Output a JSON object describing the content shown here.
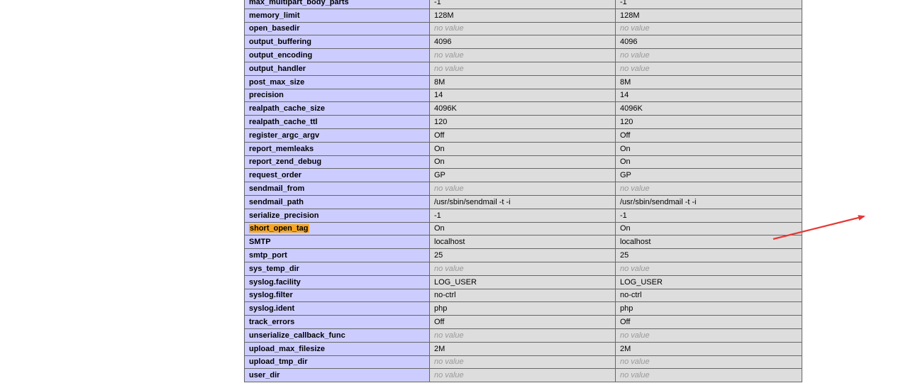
{
  "annotation": {
    "arrow_color": "#e53935",
    "arrow_target_row": "short_open_tag",
    "highlight_color": "#f5a623"
  },
  "colors": {
    "key_cell": "#ccccff",
    "value_cell": "#dddddd",
    "no_value_text": "#999999"
  },
  "rows": [
    {
      "name": "max_multipart_body_parts",
      "local": "-1",
      "master": "-1",
      "local_no": false,
      "master_no": false
    },
    {
      "name": "memory_limit",
      "local": "128M",
      "master": "128M",
      "local_no": false,
      "master_no": false
    },
    {
      "name": "open_basedir",
      "local": "no value",
      "master": "no value",
      "local_no": true,
      "master_no": true
    },
    {
      "name": "output_buffering",
      "local": "4096",
      "master": "4096",
      "local_no": false,
      "master_no": false
    },
    {
      "name": "output_encoding",
      "local": "no value",
      "master": "no value",
      "local_no": true,
      "master_no": true
    },
    {
      "name": "output_handler",
      "local": "no value",
      "master": "no value",
      "local_no": true,
      "master_no": true
    },
    {
      "name": "post_max_size",
      "local": "8M",
      "master": "8M",
      "local_no": false,
      "master_no": false
    },
    {
      "name": "precision",
      "local": "14",
      "master": "14",
      "local_no": false,
      "master_no": false
    },
    {
      "name": "realpath_cache_size",
      "local": "4096K",
      "master": "4096K",
      "local_no": false,
      "master_no": false
    },
    {
      "name": "realpath_cache_ttl",
      "local": "120",
      "master": "120",
      "local_no": false,
      "master_no": false
    },
    {
      "name": "register_argc_argv",
      "local": "Off",
      "master": "Off",
      "local_no": false,
      "master_no": false
    },
    {
      "name": "report_memleaks",
      "local": "On",
      "master": "On",
      "local_no": false,
      "master_no": false
    },
    {
      "name": "report_zend_debug",
      "local": "On",
      "master": "On",
      "local_no": false,
      "master_no": false
    },
    {
      "name": "request_order",
      "local": "GP",
      "master": "GP",
      "local_no": false,
      "master_no": false
    },
    {
      "name": "sendmail_from",
      "local": "no value",
      "master": "no value",
      "local_no": true,
      "master_no": true
    },
    {
      "name": "sendmail_path",
      "local": "/usr/sbin/sendmail -t -i",
      "master": "/usr/sbin/sendmail -t -i",
      "local_no": false,
      "master_no": false
    },
    {
      "name": "serialize_precision",
      "local": "-1",
      "master": "-1",
      "local_no": false,
      "master_no": false
    },
    {
      "name": "short_open_tag",
      "local": "On",
      "master": "On",
      "local_no": false,
      "master_no": false,
      "highlighted": true
    },
    {
      "name": "SMTP",
      "local": "localhost",
      "master": "localhost",
      "local_no": false,
      "master_no": false
    },
    {
      "name": "smtp_port",
      "local": "25",
      "master": "25",
      "local_no": false,
      "master_no": false
    },
    {
      "name": "sys_temp_dir",
      "local": "no value",
      "master": "no value",
      "local_no": true,
      "master_no": true
    },
    {
      "name": "syslog.facility",
      "local": "LOG_USER",
      "master": "LOG_USER",
      "local_no": false,
      "master_no": false
    },
    {
      "name": "syslog.filter",
      "local": "no-ctrl",
      "master": "no-ctrl",
      "local_no": false,
      "master_no": false
    },
    {
      "name": "syslog.ident",
      "local": "php",
      "master": "php",
      "local_no": false,
      "master_no": false
    },
    {
      "name": "track_errors",
      "local": "Off",
      "master": "Off",
      "local_no": false,
      "master_no": false
    },
    {
      "name": "unserialize_callback_func",
      "local": "no value",
      "master": "no value",
      "local_no": true,
      "master_no": true
    },
    {
      "name": "upload_max_filesize",
      "local": "2M",
      "master": "2M",
      "local_no": false,
      "master_no": false
    },
    {
      "name": "upload_tmp_dir",
      "local": "no value",
      "master": "no value",
      "local_no": true,
      "master_no": true
    },
    {
      "name": "user_dir",
      "local": "no value",
      "master": "no value",
      "local_no": true,
      "master_no": true
    }
  ]
}
